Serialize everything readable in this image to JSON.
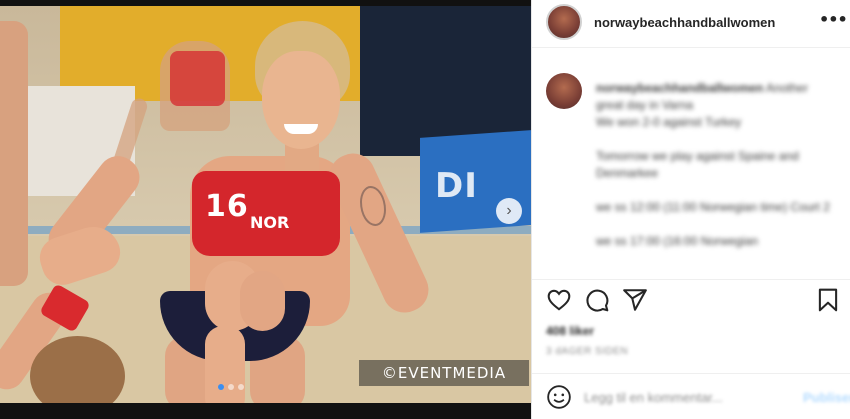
{
  "post": {
    "username": "norwaybeachhandballwomen",
    "more_icon": "more-horizontal-icon",
    "next_icon": "chevron-right-icon"
  },
  "media": {
    "watermark": "©EVENTMEDIA",
    "jersey_number": "16",
    "jersey_country": "NOR",
    "banner_text": "DI",
    "carousel_dots": 3,
    "active_dot": 0
  },
  "caption": {
    "username": "norwaybeachhandballwomen",
    "line1": "Another great day in Varna",
    "line2": "We won 2-0 against Turkey",
    "line3": "Tomorrow we play against Spaine and Denmarkee",
    "line4": "we ss 12:00 (11:00 Norwegian time) Court 2",
    "line5": "we ss 17:00 (16:00 Norwegian"
  },
  "actions": {
    "like_icon": "heart-icon",
    "comment_icon": "comment-icon",
    "share_icon": "send-icon",
    "save_icon": "bookmark-icon",
    "likes": "408 liker",
    "date": "3 dAGER SIDEN"
  },
  "comment_bar": {
    "emoji_icon": "smiley-icon",
    "placeholder": "Legg til en kommentar...",
    "post_label": "Publiser"
  }
}
